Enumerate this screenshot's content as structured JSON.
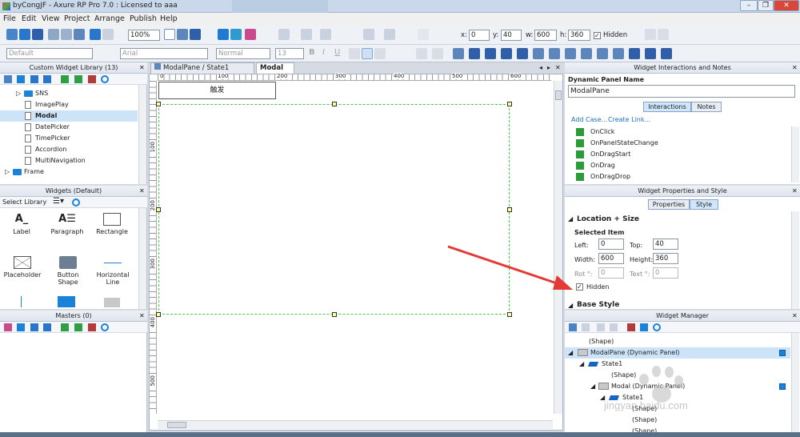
{
  "app": {
    "title": "byCongJF - Axure RP Pro 7.0 : Licensed to aaa"
  },
  "menu": [
    "File",
    "Edit",
    "View",
    "Project",
    "Arrange",
    "Publish",
    "Help"
  ],
  "toolbar": {
    "zoom": "100%",
    "x_label": "x:",
    "x": "0",
    "y_label": "y:",
    "y": "40",
    "w_label": "w:",
    "w": "600",
    "h_label": "h:",
    "h": "360",
    "hidden_label": "Hidden",
    "font": "Default",
    "font_family": "Arial",
    "style": "Normal",
    "font_size": "13"
  },
  "custom_lib": {
    "title": "Custom Widget Library (13)",
    "items": [
      "SNS",
      "ImagePlay",
      "Modal",
      "DatePicker",
      "TimePicker",
      "Accordion",
      "MultiNavigation",
      "Frame"
    ]
  },
  "widgets": {
    "title": "Widgets (Default)",
    "select_label": "Select Library",
    "items": [
      "Label",
      "Paragraph",
      "Rectangle",
      "Placeholder",
      "Button Shape",
      "Horizontal Line"
    ]
  },
  "masters": {
    "title": "Masters (0)"
  },
  "tabs": [
    "ModalPane / State1 (Modal)",
    "Modal"
  ],
  "ruler": {
    "h": [
      "0",
      "100",
      "200",
      "300",
      "400",
      "500",
      "600"
    ],
    "v": [
      "100",
      "200",
      "300",
      "400",
      "500"
    ]
  },
  "canvas": {
    "button_text": "触发"
  },
  "interactions": {
    "title": "Widget Interactions and Notes",
    "name_label": "Dynamic Panel Name",
    "name_value": "ModalPane",
    "tab_interactions": "Interactions",
    "tab_notes": "Notes",
    "add_case": "Add Case...",
    "create_link": "Create Link...",
    "events": [
      "OnClick",
      "OnPanelStateChange",
      "OnDragStart",
      "OnDrag",
      "OnDragDrop"
    ]
  },
  "props": {
    "title": "Widget Properties and Style",
    "tab_properties": "Properties",
    "tab_style": "Style",
    "section": "Location + Size",
    "selected": "Selected Item",
    "left_label": "Left:",
    "left": "0",
    "top_label": "Top:",
    "top": "40",
    "width_label": "Width:",
    "width": "600",
    "height_label": "Height:",
    "height": "360",
    "rot_label": "Rot °:",
    "rot": "0",
    "text_label": "Text °:",
    "text": "0",
    "hidden_label": "Hidden",
    "base_style": "Base Style"
  },
  "manager": {
    "title": "Widget Manager",
    "rows": [
      "(Shape)",
      "ModalPane (Dynamic Panel)",
      "State1",
      "(Shape)",
      "Modal (Dynamic Panel)",
      "State1",
      "(Shape)",
      "(Shape)",
      "(Shape)"
    ]
  },
  "watermark": "jingyan.baidu.com",
  "colors": {
    "accent": "#1a82d8",
    "arrow": "#e53935",
    "selection": "#44cc44"
  }
}
